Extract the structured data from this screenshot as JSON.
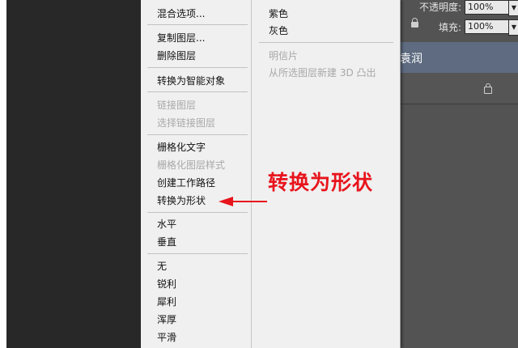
{
  "colors": {
    "canvas_bg": "#282828",
    "menu_bg": "#f0f0f0",
    "panel_bg": "#535353",
    "selected_layer": "#5e6b80",
    "annotation_red": "#e8141c"
  },
  "layers_panel": {
    "opacity_label": "不透明度:",
    "opacity_value": "100%",
    "fill_label": "填充:",
    "fill_value": "100%",
    "selected_layer_text": "袁润"
  },
  "context_menu": {
    "left_column": {
      "blending_options": "混合选项...",
      "duplicate_layer": "复制图层...",
      "delete_layer": "删除图层",
      "convert_to_smart_object": "转换为智能对象",
      "link_layers": "链接图层",
      "select_linked_layers": "选择链接图层",
      "rasterize_type": "栅格化文字",
      "rasterize_layer_style": "栅格化图层样式",
      "create_work_path": "创建工作路径",
      "convert_to_shape": "转换为形状",
      "horizontal": "水平",
      "vertical": "垂直",
      "none": "无",
      "sharp": "锐利",
      "crisp": "犀利",
      "strong": "浑厚",
      "smooth": "平滑"
    },
    "right_column": {
      "violet": "紫色",
      "gray": "灰色",
      "postcard": "明信片",
      "new_3d_extrusion": "从所选图层新建 3D 凸出"
    }
  },
  "annotation": {
    "text": "转换为形状"
  }
}
